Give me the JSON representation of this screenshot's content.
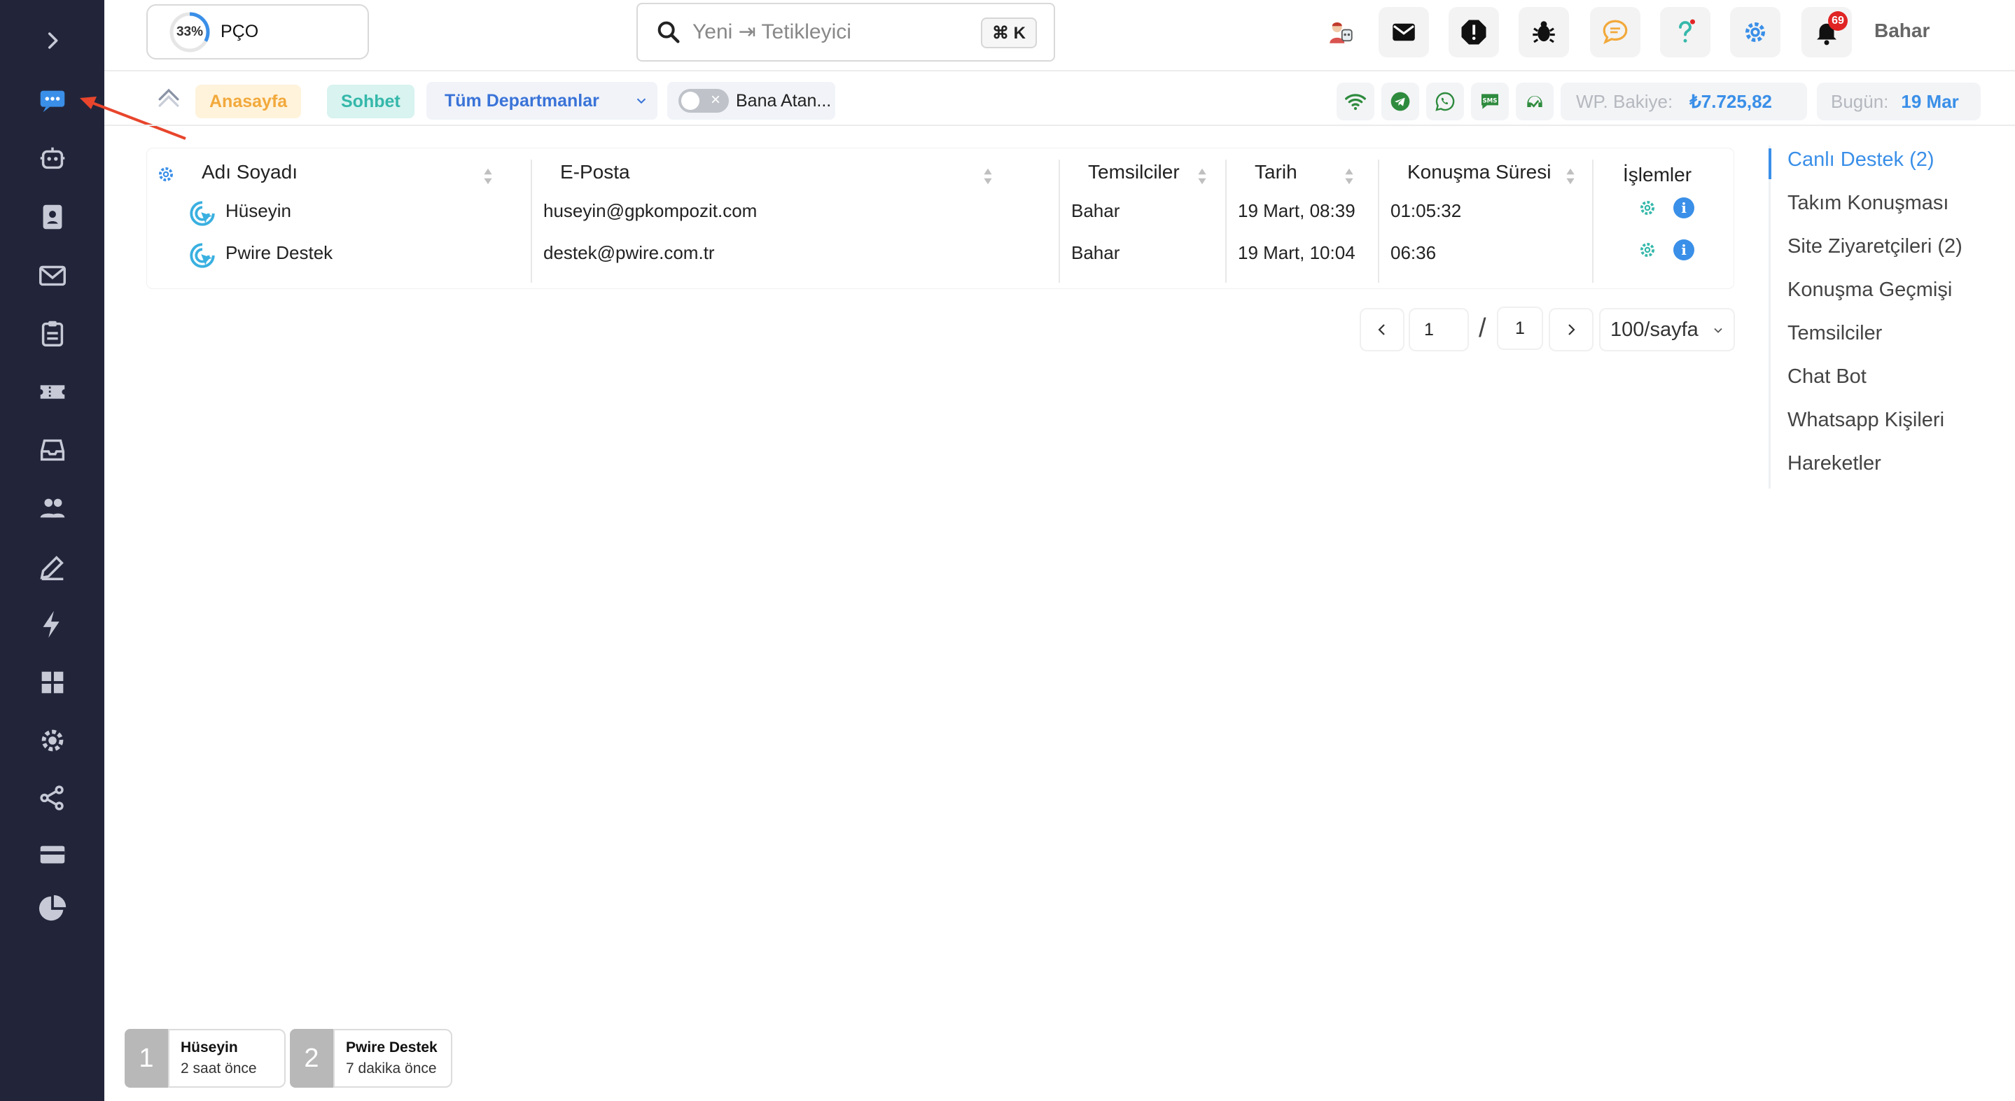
{
  "progress": {
    "percent_label": "33%",
    "percent": 33,
    "name": "PÇO"
  },
  "search": {
    "placeholder": "Yeni ⇥ Tetikleyici",
    "shortcut": "⌘ K"
  },
  "notifications": {
    "count": "69"
  },
  "user": {
    "name": "Bahar"
  },
  "subbar": {
    "home_tag": "Anasayfa",
    "chat_tag": "Sohbet",
    "department_select": "Tüm Departmanlar",
    "assigned_toggle_label": "Bana Atan...",
    "wp_balance_label": "WP. Bakiye:",
    "wp_balance_value": "₺7.725,82",
    "today_label": "Bugün:",
    "today_value": "19 Mar"
  },
  "table": {
    "columns": [
      "Adı Soyadı",
      "E-Posta",
      "Temsilciler",
      "Tarih",
      "Konuşma Süresi",
      "İşlemler"
    ],
    "rows": [
      {
        "name": "Hüseyin",
        "email": "huseyin@gpkompozit.com",
        "agent": "Bahar",
        "date": "19 Mart, 08:39",
        "duration": "01:05:32"
      },
      {
        "name": "Pwire Destek",
        "email": "destek@pwire.com.tr",
        "agent": "Bahar",
        "date": "19 Mart, 10:04",
        "duration": "06:36"
      }
    ]
  },
  "pagination": {
    "current": "1",
    "separator": "/",
    "total": "1",
    "page_size": "100/sayfa"
  },
  "right_nav": {
    "items": [
      "Canlı Destek (2)",
      "Takım Konuşması",
      "Site Ziyaretçileri (2)",
      "Konuşma Geçmişi",
      "Temsilciler",
      "Chat Bot",
      "Whatsapp Kişileri",
      "Hareketler"
    ],
    "active_index": 0
  },
  "open_chats": [
    {
      "index": "1",
      "name": "Hüseyin",
      "time": "2 saat önce"
    },
    {
      "index": "2",
      "name": "Pwire Destek",
      "time": "7 dakika önce"
    }
  ],
  "sidebar_icons": [
    "expand-chevron-icon",
    "live-chat-icon",
    "bot-icon",
    "contact-card-icon",
    "mail-icon",
    "clipboard-icon",
    "ticket-icon",
    "inbox-icon",
    "users-icon",
    "edit-icon",
    "lightning-icon",
    "dashboard-grid-icon",
    "settings-gear-icon",
    "share-icon",
    "card-icon",
    "pie-chart-icon"
  ],
  "colors": {
    "sidebar": "#22253a",
    "accent": "#3a8fe8",
    "teal": "#35b8aa",
    "orange": "#f2a93b",
    "alert_red": "#e02424"
  }
}
